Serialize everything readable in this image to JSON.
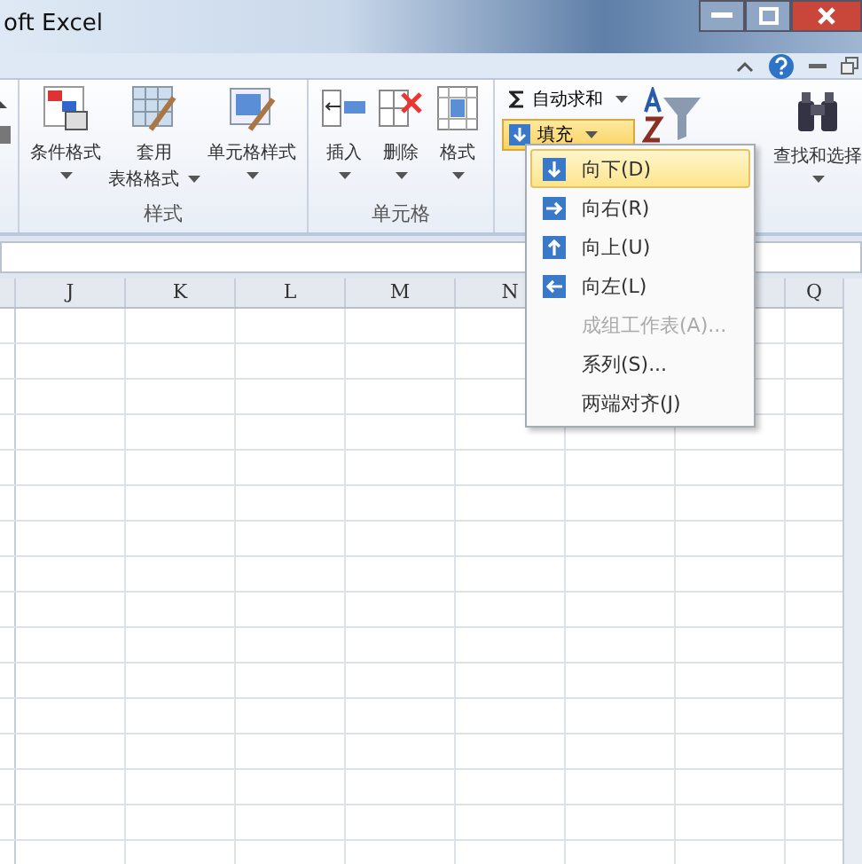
{
  "window": {
    "title": "oft Excel"
  },
  "ribbon": {
    "groups": [
      {
        "label": "样式",
        "buttons": [
          {
            "lines": [
              "条件格式"
            ],
            "dropdown": true
          },
          {
            "lines": [
              "套用",
              "表格格式"
            ],
            "dropdown": true
          },
          {
            "lines": [
              "单元格样式"
            ],
            "dropdown": true
          }
        ]
      },
      {
        "label": "单元格",
        "buttons": [
          {
            "lines": [
              "插入"
            ],
            "dropdown": true
          },
          {
            "lines": [
              "删除"
            ],
            "dropdown": true
          },
          {
            "lines": [
              "格式"
            ],
            "dropdown": true
          }
        ]
      }
    ],
    "editing": {
      "autosum": {
        "label": "自动求和",
        "dropdown": true
      },
      "fill": {
        "label": "填充",
        "dropdown": true,
        "selected": true
      },
      "find": {
        "lines": [
          "查找和选择"
        ],
        "dropdown": true
      }
    }
  },
  "fill_menu": [
    {
      "label": "向下(D)",
      "kind": "arrow",
      "selected": true,
      "disabled": false
    },
    {
      "label": "向右(R)",
      "kind": "arrow",
      "selected": false,
      "disabled": false
    },
    {
      "label": "向上(U)",
      "kind": "arrow",
      "selected": false,
      "disabled": false
    },
    {
      "label": "向左(L)",
      "kind": "arrow",
      "selected": false,
      "disabled": false
    },
    {
      "label": "成组工作表(A)...",
      "kind": "plain",
      "selected": false,
      "disabled": true
    },
    {
      "label": "系列(S)...",
      "kind": "plain",
      "selected": false,
      "disabled": false
    },
    {
      "label": "两端对齐(J)",
      "kind": "plain",
      "selected": false,
      "disabled": false
    }
  ],
  "sheet": {
    "columns": [
      "J",
      "K",
      "L",
      "M",
      "N",
      "",
      "",
      "Q"
    ]
  }
}
